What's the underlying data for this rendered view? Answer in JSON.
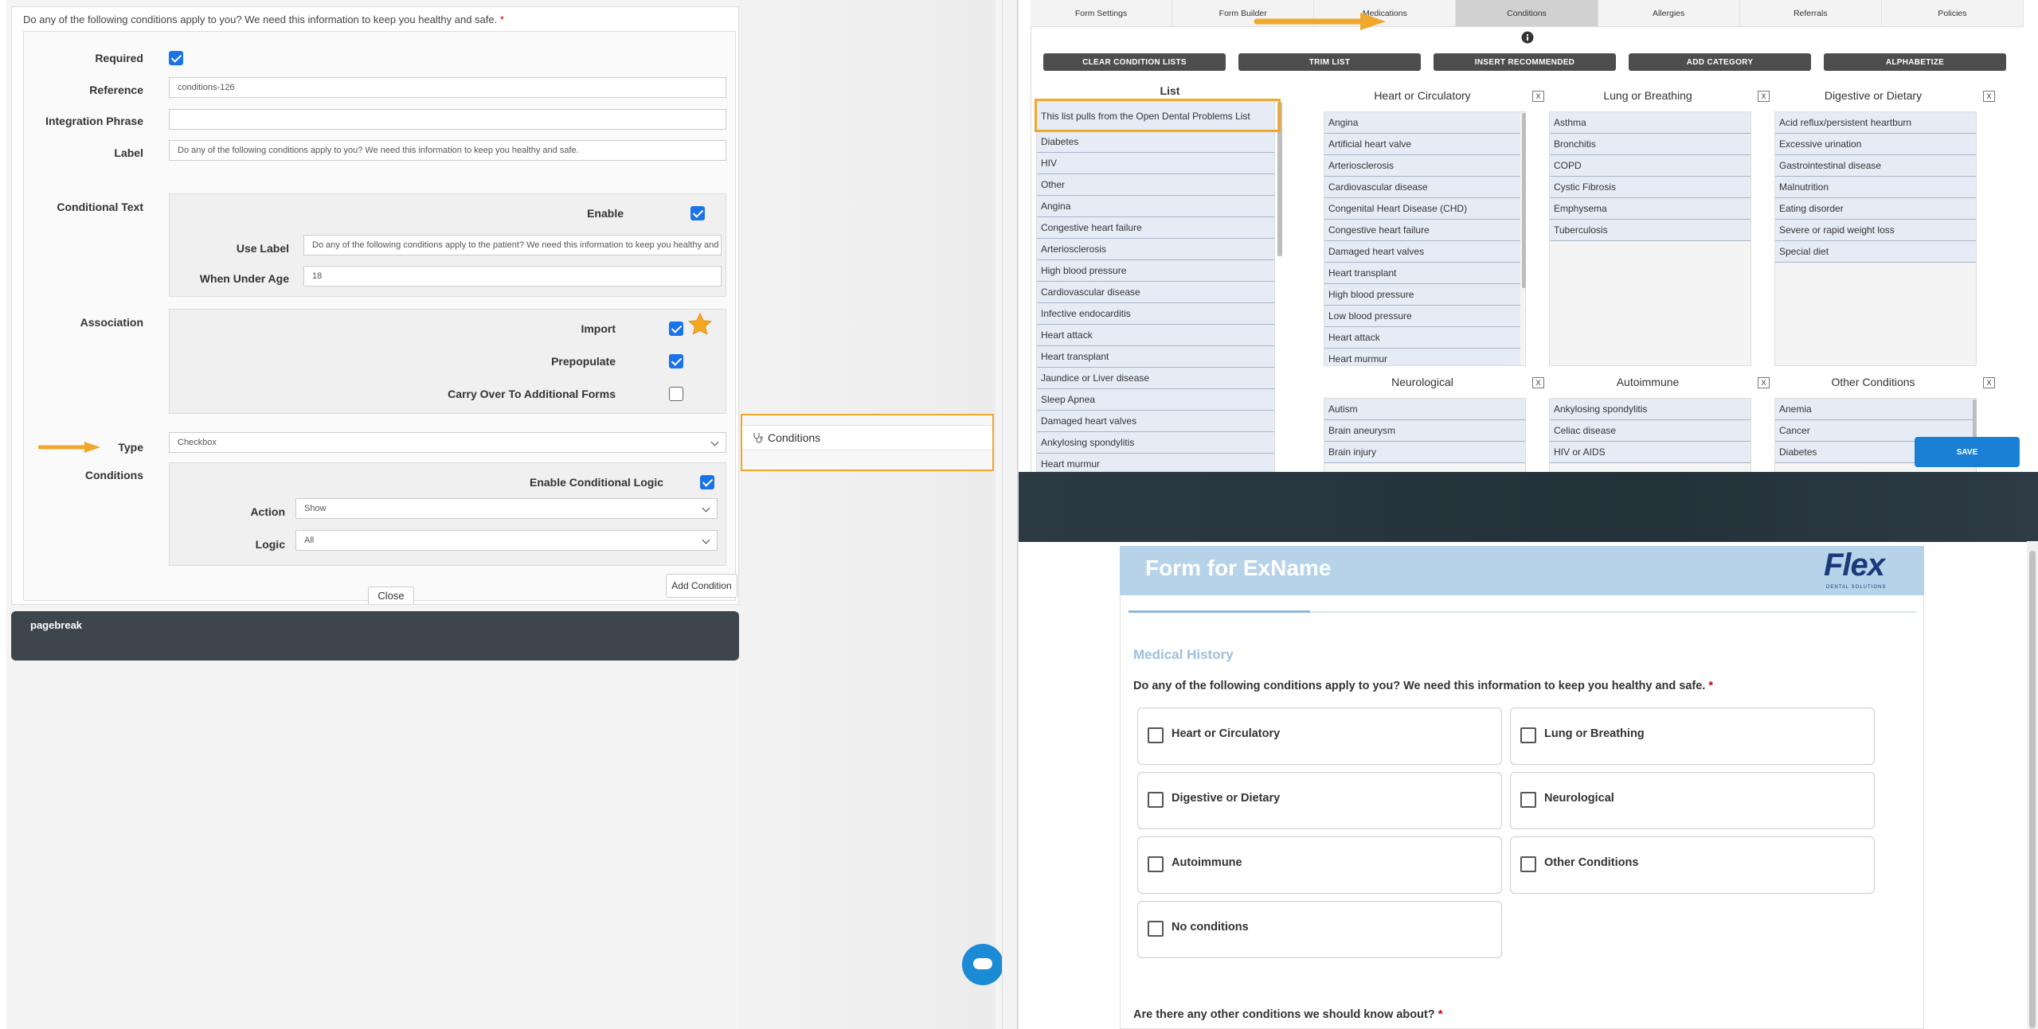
{
  "left_panel": {
    "question_title": "Do any of the following conditions apply to you? We need this information to keep you healthy and safe.",
    "required_mark": "*",
    "fields": {
      "required_label": "Required",
      "reference_label": "Reference",
      "reference_value": "conditions-126",
      "integration_label": "Integration Phrase",
      "integration_value": "",
      "label_label": "Label",
      "label_value": "Do any of the following conditions apply to you? We need this information to keep you healthy and safe."
    },
    "conditional_text": {
      "section_label": "Conditional Text",
      "enable_label": "Enable",
      "use_label_label": "Use Label",
      "use_label_value": "Do any of the following conditions apply to the patient? We need this information to keep you healthy and safe.",
      "under_age_label": "When Under Age",
      "under_age_value": "18"
    },
    "association": {
      "section_label": "Association",
      "import_label": "Import",
      "prepopulate_label": "Prepopulate",
      "carry_over_label": "Carry Over To Additional Forms"
    },
    "type": {
      "label": "Type",
      "value": "Checkbox"
    },
    "conditions": {
      "section_label": "Conditions",
      "enable_logic_label": "Enable Conditional Logic",
      "action_label": "Action",
      "action_value": "Show",
      "logic_label": "Logic",
      "logic_value": "All",
      "add_condition": "Add Condition",
      "close": "Close"
    },
    "pagebreak": "pagebreak",
    "conditions_item": "Conditions"
  },
  "editor": {
    "tabs": [
      "Form Settings",
      "Form Builder",
      "Medications",
      "Conditions",
      "Allergies",
      "Referrals",
      "Policies"
    ],
    "active_tab": "Conditions",
    "buttons": [
      "CLEAR CONDITION LISTS",
      "TRIM LIST",
      "INSERT RECOMMENDED",
      "ADD CATEGORY",
      "ALPHABETIZE"
    ],
    "list_title": "List",
    "list_items": [
      "This list pulls from the Open Dental Problems List",
      "Diabetes",
      "HIV",
      "Other",
      "Angina",
      "Congestive heart failure",
      "Arteriosclerosis",
      "High blood pressure",
      "Cardiovascular disease",
      "Infective endocarditis",
      "Heart attack",
      "Heart transplant",
      "Jaundice or Liver disease",
      "Sleep Apnea",
      "Damaged heart valves",
      "Ankylosing spondylitis",
      "Heart murmur"
    ],
    "categories": [
      {
        "title": "Heart or Circulatory",
        "items": [
          "Angina",
          "Artificial heart valve",
          "Arteriosclerosis",
          "Cardiovascular disease",
          "Congenital Heart Disease (CHD)",
          "Congestive heart failure",
          "Damaged heart valves",
          "Heart transplant",
          "High blood pressure",
          "Low blood pressure",
          "Heart attack",
          "Heart murmur"
        ]
      },
      {
        "title": "Lung or Breathing",
        "items": [
          "Asthma",
          "Bronchitis",
          "COPD",
          "Cystic Fibrosis",
          "Emphysema",
          "Tuberculosis"
        ]
      },
      {
        "title": "Digestive or Dietary",
        "items": [
          "Acid reflux/persistent heartburn",
          "Excessive urination",
          "Gastrointestinal disease",
          "Malnutrition",
          "Eating disorder",
          "Severe or rapid weight loss",
          "Special diet"
        ]
      },
      {
        "title": "Neurological",
        "items": [
          "Autism",
          "Brain aneurysm",
          "Brain injury"
        ]
      },
      {
        "title": "Autoimmune",
        "items": [
          "Ankylosing spondylitis",
          "Celiac disease",
          "HIV or AIDS"
        ]
      },
      {
        "title": "Other Conditions",
        "items": [
          "Anemia",
          "Cancer",
          "Diabetes"
        ]
      }
    ],
    "remove_label": "X",
    "save": "SAVE"
  },
  "preview": {
    "form_title": "Form for ExName",
    "logo_text": "Flex",
    "logo_sub": "DENTAL SOLUTIONS",
    "section_title": "Medical History",
    "question": "Do any of the following conditions apply to you? We need this information to keep you healthy and safe.",
    "options": [
      "Heart or Circulatory",
      "Lung or Breathing",
      "Digestive or Dietary",
      "Neurological",
      "Autoimmune",
      "Other Conditions",
      "No conditions"
    ],
    "next_question": "Are there any other conditions we should know about?"
  },
  "colors": {
    "accent_orange": "#f0a82a",
    "primary_blue": "#1a80d6",
    "checkbox_blue": "#1a73e8",
    "dark_button": "#4d4d4d"
  }
}
